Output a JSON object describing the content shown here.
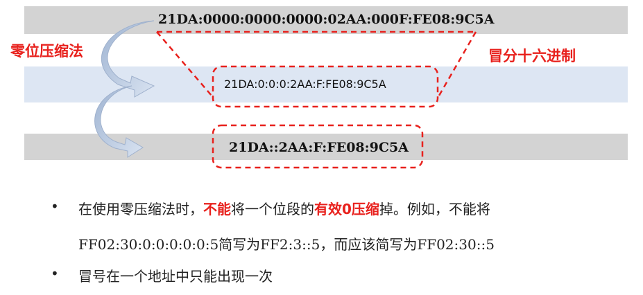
{
  "addresses": {
    "full": "21DA:0000:0000:0000:02AA:000F:FE08:9C5A",
    "compact": "21DA:0:0:0:2AA:F:FE08:9C5A",
    "zero_compressed": "21DA::2AA:F:FE08:9C5A"
  },
  "labels": {
    "zero_compression": "零位压缩法",
    "colon_hex": "冒分十六进制"
  },
  "colors": {
    "accent": "#e8211d",
    "band_gray": "#d3d3d3",
    "band_blue": "#dde6f3",
    "arrow": "#b7c8e0"
  },
  "bullets": {
    "b1": {
      "p1": "在使用零压缩法时，",
      "p2": "不能",
      "p3": "将一个位段的",
      "p4": "有效0压缩",
      "p5": "掉。例如，不能将",
      "l2a": "FF02:30:0:0:0:0:0:5",
      "l2b": "简写为",
      "l2c": "FF2:3::5",
      "l2d": "，而应该简写为",
      "l2e": "FF02:30::5"
    },
    "b2": "冒号在一个地址中只能出现一次"
  }
}
